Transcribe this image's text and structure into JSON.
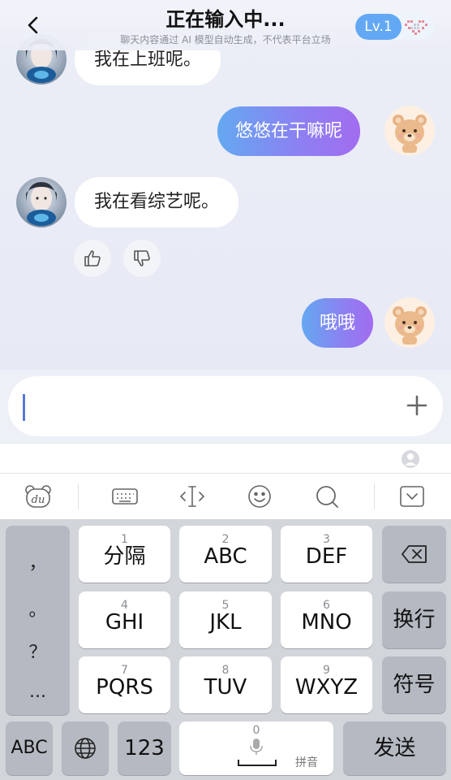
{
  "header": {
    "title": "正在输入中...",
    "subtitle": "聊天内容通过 AI 模型自动生成，不代表平台立场",
    "level": "Lv.1"
  },
  "messages": [
    {
      "side": "left",
      "text": "我在上班呢。"
    },
    {
      "side": "right",
      "text": "悠悠在干嘛呢"
    },
    {
      "side": "left",
      "text": "我在看综艺呢。"
    },
    {
      "side": "right",
      "text": "哦哦"
    }
  ],
  "input": {
    "value": ""
  },
  "keyboard": {
    "toolbar": [
      "du-logo-icon",
      "keyboard-icon",
      "cursor-move-icon",
      "emoji-icon",
      "search-icon",
      "collapse-icon"
    ],
    "punct": [
      "，",
      "。",
      "？",
      "..."
    ],
    "row1": [
      {
        "num": "1",
        "label": "分隔"
      },
      {
        "num": "2",
        "label": "ABC"
      },
      {
        "num": "3",
        "label": "DEF"
      }
    ],
    "row2": [
      {
        "num": "4",
        "label": "GHI"
      },
      {
        "num": "5",
        "label": "JKL"
      },
      {
        "num": "6",
        "label": "MNO"
      }
    ],
    "row3": [
      {
        "num": "7",
        "label": "PQRS"
      },
      {
        "num": "8",
        "label": "TUV"
      },
      {
        "num": "9",
        "label": "WXYZ"
      }
    ],
    "newline": "换行",
    "symbols": "符号",
    "abc": "ABC",
    "num123": "123",
    "space_num": "0",
    "pinyin": "拼音",
    "send": "发送"
  }
}
